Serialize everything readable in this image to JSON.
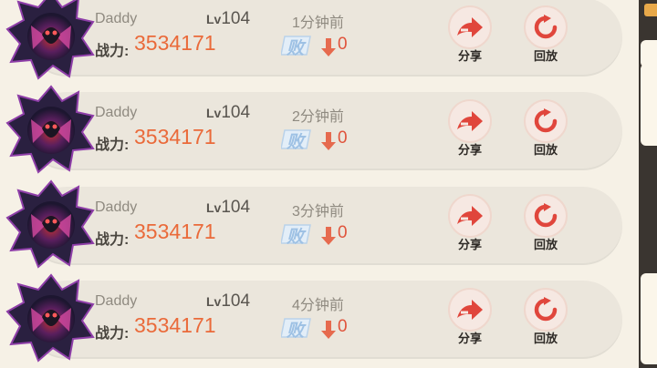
{
  "battles": [
    {
      "name": "Daddy",
      "lv_prefix": "Lv",
      "level": "104",
      "power_label": "战力:",
      "power": "3534171",
      "time": "1分钟前",
      "result": "败",
      "delta": "0",
      "share_label": "分享",
      "replay_label": "回放"
    },
    {
      "name": "Daddy",
      "lv_prefix": "Lv",
      "level": "104",
      "power_label": "战力:",
      "power": "3534171",
      "time": "2分钟前",
      "result": "败",
      "delta": "0",
      "share_label": "分享",
      "replay_label": "回放"
    },
    {
      "name": "Daddy",
      "lv_prefix": "Lv",
      "level": "104",
      "power_label": "战力:",
      "power": "3534171",
      "time": "3分钟前",
      "result": "败",
      "delta": "0",
      "share_label": "分享",
      "replay_label": "回放"
    },
    {
      "name": "Daddy",
      "lv_prefix": "Lv",
      "level": "104",
      "power_label": "战力:",
      "power": "3534171",
      "time": "4分钟前",
      "result": "败",
      "delta": "0",
      "share_label": "分享",
      "replay_label": "回放"
    }
  ],
  "icons": {
    "avatar": "dark-dragon-avatar",
    "share": "share-arrow-icon",
    "replay": "replay-icon",
    "delta": "arrow-down-icon"
  },
  "colors": {
    "background": "#f6f1e6",
    "row": "#ebe6dc",
    "power": "#ea6a3a",
    "accent": "#e0463c",
    "result": "#9ec1e4"
  }
}
